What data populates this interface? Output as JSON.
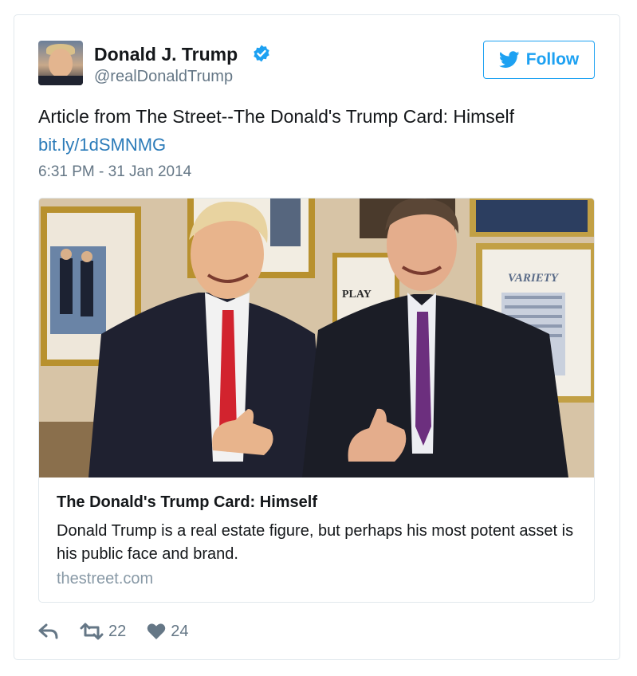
{
  "author": {
    "name": "Donald J. Trump",
    "handle": "@realDonaldTrump",
    "avatar_icon": "profile-photo"
  },
  "follow_button": {
    "label": "Follow",
    "icon": "twitter-bird-icon"
  },
  "tweet": {
    "text": "Article from The Street--The Donald's Trump Card: Himself",
    "link": "bit.ly/1dSMNMG",
    "timestamp": "6:31 PM - 31 Jan 2014"
  },
  "card": {
    "title": "The Donald's Trump Card: Himself",
    "description": "Donald Trump is a real estate figure, but perhaps his most potent asset is his public face and brand.",
    "domain": "thestreet.com",
    "image_sign_text": "PLAY",
    "image_magazine_text": "VARIETY"
  },
  "actions": {
    "retweets": "22",
    "likes": "24"
  },
  "colors": {
    "accent": "#1da1f2",
    "link": "#2b7bb9",
    "verified": "#1da1f2",
    "muted": "#657786"
  }
}
